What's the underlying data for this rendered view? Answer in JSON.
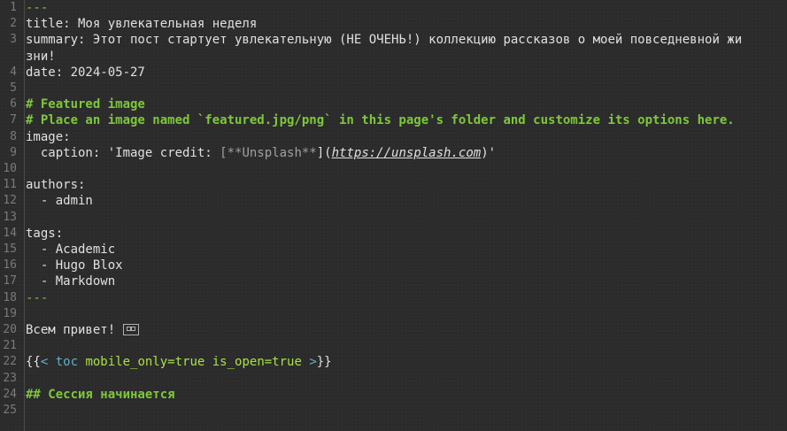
{
  "lines": [
    {
      "n": "1",
      "text": "---"
    },
    {
      "n": "2",
      "text": "title: Моя увлекательная неделя"
    },
    {
      "n": "3",
      "text": "summary: Этот пост стартует увлекательную (НЕ ОЧЕНЬ!) коллекцию рассказов о моей повседневной жизни!"
    },
    {
      "n": "4",
      "text": "date: 2024-05-27"
    },
    {
      "n": "5",
      "text": ""
    },
    {
      "n": "6",
      "text": "# Featured image"
    },
    {
      "n": "7",
      "text": "# Place an image named `featured.jpg/png` in this page's folder and customize its options here."
    },
    {
      "n": "8",
      "text": "image:"
    },
    {
      "n": "9",
      "pre": "  caption: 'Image credit: ",
      "bracket_open": "[",
      "bold_md": "**Unsplash**",
      "bracket_close": "](",
      "url": "https://unsplash.com",
      "tail": ")'"
    },
    {
      "n": "10",
      "text": ""
    },
    {
      "n": "11",
      "text": "authors:"
    },
    {
      "n": "12",
      "text": "  - admin"
    },
    {
      "n": "13",
      "text": ""
    },
    {
      "n": "14",
      "text": "tags:"
    },
    {
      "n": "15",
      "text": "  - Academic"
    },
    {
      "n": "16",
      "text": "  - Hugo Blox"
    },
    {
      "n": "17",
      "text": "  - Markdown"
    },
    {
      "n": "18",
      "text": "---"
    },
    {
      "n": "19",
      "text": ""
    },
    {
      "n": "20",
      "text": "Всем привет! "
    },
    {
      "n": "21",
      "text": ""
    },
    {
      "n": "22",
      "open": "{{",
      "lt": "<",
      "name": " toc ",
      "arg1": "mobile_only=true is_open=true",
      "gt": " >",
      "close": "}}"
    },
    {
      "n": "23",
      "text": ""
    },
    {
      "n": "24",
      "text": "## Сессия начинается"
    },
    {
      "n": "25",
      "text": ""
    }
  ]
}
